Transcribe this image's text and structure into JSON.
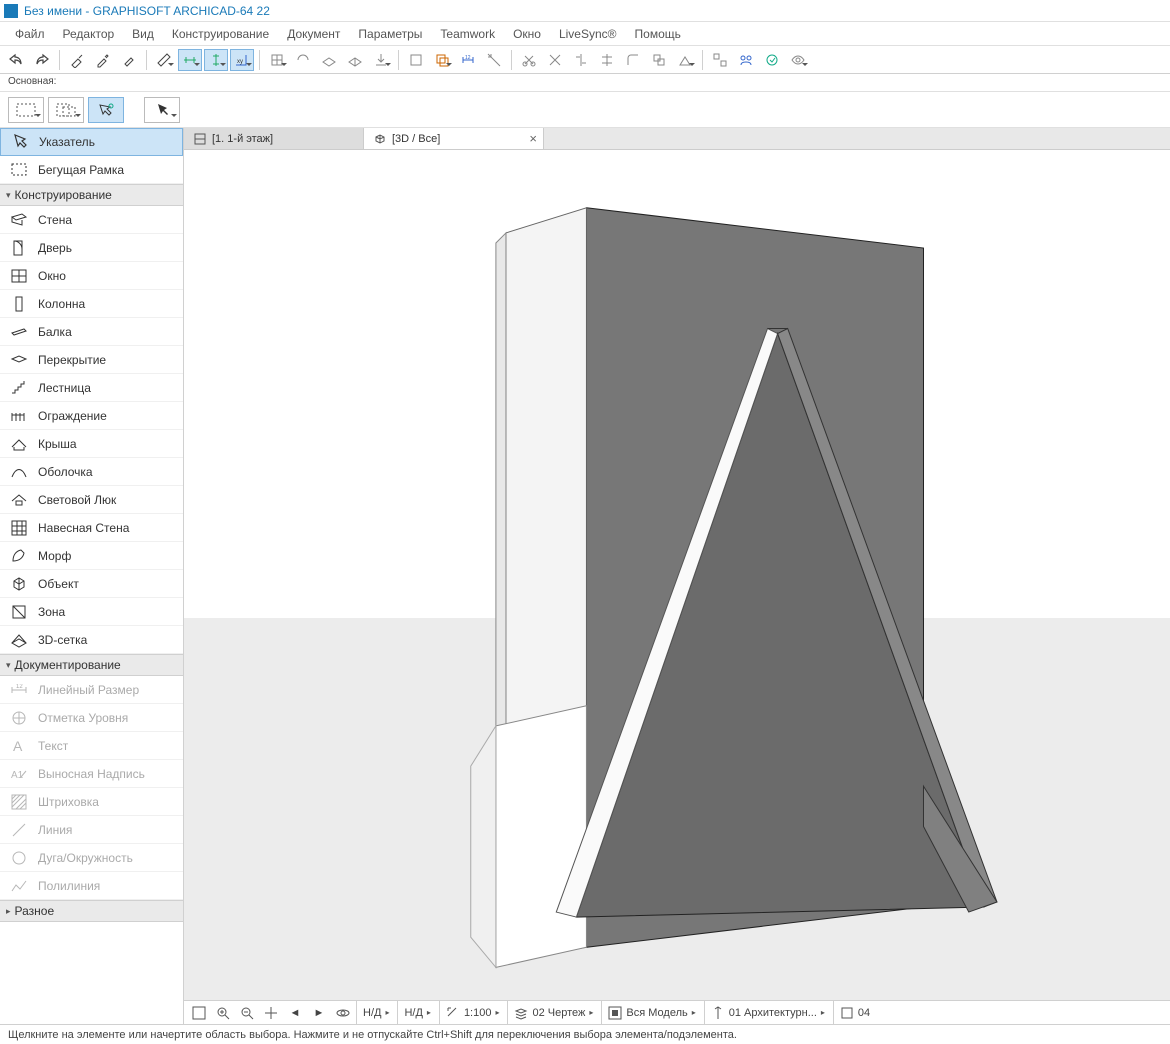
{
  "title": "Без имени - GRAPHISOFT ARCHICAD-64 22",
  "menu": [
    "Файл",
    "Редактор",
    "Вид",
    "Конструирование",
    "Документ",
    "Параметры",
    "Teamwork",
    "Окно",
    "LiveSync®",
    "Помощь"
  ],
  "sublabel": "Основная:",
  "toolbox": {
    "top": [
      {
        "label": "Указатель",
        "selected": true
      },
      {
        "label": "Бегущая Рамка"
      }
    ],
    "groups": [
      {
        "title": "Конструирование",
        "items": [
          {
            "label": "Стена"
          },
          {
            "label": "Дверь"
          },
          {
            "label": "Окно"
          },
          {
            "label": "Колонна"
          },
          {
            "label": "Балка"
          },
          {
            "label": "Перекрытие"
          },
          {
            "label": "Лестница"
          },
          {
            "label": "Ограждение"
          },
          {
            "label": "Крыша"
          },
          {
            "label": "Оболочка"
          },
          {
            "label": "Световой Люк"
          },
          {
            "label": "Навесная Стена"
          },
          {
            "label": "Морф"
          },
          {
            "label": "Объект"
          },
          {
            "label": "Зона"
          },
          {
            "label": "3D-сетка"
          }
        ]
      },
      {
        "title": "Документирование",
        "items": [
          {
            "label": "Линейный Размер",
            "dis": true
          },
          {
            "label": "Отметка Уровня",
            "dis": true
          },
          {
            "label": "Текст",
            "dis": true
          },
          {
            "label": "Выносная Надпись",
            "dis": true
          },
          {
            "label": "Штриховка",
            "dis": true
          },
          {
            "label": "Линия",
            "dis": true
          },
          {
            "label": "Дуга/Окружность",
            "dis": true
          },
          {
            "label": "Полилиния",
            "dis": true
          }
        ]
      },
      {
        "title": "Разное",
        "collapsed": true,
        "items": []
      }
    ]
  },
  "tabs": [
    {
      "label": "[1. 1-й этаж]",
      "active": false,
      "icon": "plan"
    },
    {
      "label": "[3D / Все]",
      "active": true,
      "icon": "3d",
      "closable": true
    }
  ],
  "viewbar": {
    "na1": "Н/Д",
    "na2": "Н/Д",
    "scale": "1:100",
    "drawing": "02 Чертеж",
    "model": "Вся Модель",
    "arch": "01 Архитектурн...",
    "right": "04"
  },
  "status": "Щелкните на элементе или начертите область выбора. Нажмите и не отпускайте Ctrl+Shift для переключения выбора элемента/подэлемента."
}
